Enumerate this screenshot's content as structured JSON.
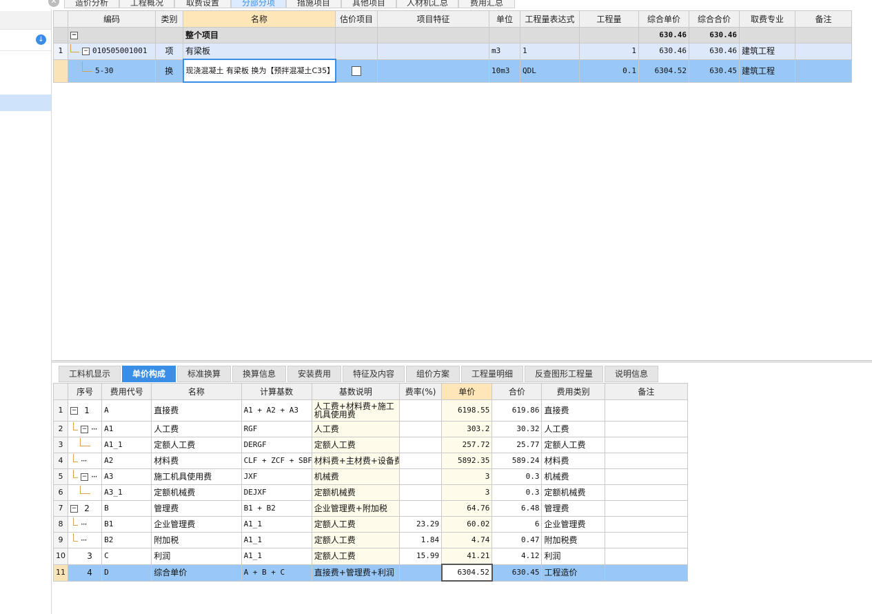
{
  "top_tabs": [
    "造价分析",
    "工程概况",
    "取费设置",
    "分部分项",
    "措施项目",
    "其他项目",
    "人材机汇总",
    "费用汇总"
  ],
  "top_tab_active": 3,
  "close_glyph": "✕",
  "sidebar": {
    "download_glyph": "↓"
  },
  "upper_table": {
    "headers": [
      "编码",
      "类别",
      "名称",
      "估价项目",
      "项目特征",
      "单位",
      "工程量表达式",
      "工程量",
      "综合单价",
      "综合合价",
      "取费专业",
      "备注"
    ],
    "total_row": {
      "name": "整个项目",
      "unit_price": "630.46",
      "total": "630.46"
    },
    "rows": [
      {
        "index": "1",
        "code": "010505001001",
        "category": "项",
        "name": "有梁板",
        "unit": "m3",
        "qty_expr": "1",
        "qty": "1",
        "unit_price": "630.46",
        "total": "630.46",
        "fee_type": "建筑工程",
        "remark": ""
      },
      {
        "index": "",
        "code": "5-30",
        "category": "换",
        "name": "现浇混凝土 有梁板   换为【预拌混凝土C35】",
        "unit": "10m3",
        "qty_expr": "QDL",
        "qty": "0.1",
        "unit_price": "6304.52",
        "total": "630.45",
        "fee_type": "建筑工程",
        "remark": ""
      }
    ]
  },
  "bottom_tabs": [
    "工料机显示",
    "单价构成",
    "标准换算",
    "换算信息",
    "安装费用",
    "特征及内容",
    "组价方案",
    "工程量明细",
    "反查图形工程量",
    "说明信息"
  ],
  "bottom_tab_active": 1,
  "lower_table": {
    "headers": [
      "序号",
      "费用代号",
      "名称",
      "计算基数",
      "基数说明",
      "费率(%)",
      "单价",
      "合价",
      "费用类别",
      "备注"
    ],
    "rows": [
      {
        "index": "1",
        "seq": "1",
        "code": "A",
        "name": "直接费",
        "base": "A1 + A2 + A3",
        "base_desc": "人工费+材料费+施工机具使用费",
        "rate": "",
        "unit_price": "6198.55",
        "total": "619.86",
        "fee_cat": "直接费",
        "remark": ""
      },
      {
        "index": "2",
        "seq": "",
        "code": "A1",
        "name": "人工费",
        "base": "RGF",
        "base_desc": "人工费",
        "rate": "",
        "unit_price": "303.2",
        "total": "30.32",
        "fee_cat": "人工费",
        "remark": ""
      },
      {
        "index": "3",
        "seq": "",
        "code": "A1_1",
        "name": "定额人工费",
        "base": "DERGF",
        "base_desc": "定额人工费",
        "rate": "",
        "unit_price": "257.72",
        "total": "25.77",
        "fee_cat": "定额人工费",
        "remark": ""
      },
      {
        "index": "4",
        "seq": "",
        "code": "A2",
        "name": "材料费",
        "base": "CLF + ZCF + SBF",
        "base_desc": "材料费+主材费+设备费",
        "rate": "",
        "unit_price": "5892.35",
        "total": "589.24",
        "fee_cat": "材料费",
        "remark": ""
      },
      {
        "index": "5",
        "seq": "",
        "code": "A3",
        "name": "施工机具使用费",
        "base": "JXF",
        "base_desc": "机械费",
        "rate": "",
        "unit_price": "3",
        "total": "0.3",
        "fee_cat": "机械费",
        "remark": ""
      },
      {
        "index": "6",
        "seq": "",
        "code": "A3_1",
        "name": "定额机械费",
        "base": "DEJXF",
        "base_desc": "定额机械费",
        "rate": "",
        "unit_price": "3",
        "total": "0.3",
        "fee_cat": "定额机械费",
        "remark": ""
      },
      {
        "index": "7",
        "seq": "2",
        "code": "B",
        "name": "管理费",
        "base": "B1 + B2",
        "base_desc": "企业管理费+附加税",
        "rate": "",
        "unit_price": "64.76",
        "total": "6.48",
        "fee_cat": "管理费",
        "remark": ""
      },
      {
        "index": "8",
        "seq": "",
        "code": "B1",
        "name": "企业管理费",
        "base": "A1_1",
        "base_desc": "定额人工费",
        "rate": "23.29",
        "unit_price": "60.02",
        "total": "6",
        "fee_cat": "企业管理费",
        "remark": ""
      },
      {
        "index": "9",
        "seq": "",
        "code": "B2",
        "name": "附加税",
        "base": "A1_1",
        "base_desc": "定额人工费",
        "rate": "1.84",
        "unit_price": "4.74",
        "total": "0.47",
        "fee_cat": "附加税费",
        "remark": ""
      },
      {
        "index": "10",
        "seq": "3",
        "code": "C",
        "name": "利润",
        "base": "A1_1",
        "base_desc": "定额人工费",
        "rate": "15.99",
        "unit_price": "41.21",
        "total": "4.12",
        "fee_cat": "利润",
        "remark": ""
      },
      {
        "index": "11",
        "seq": "4",
        "code": "D",
        "name": "综合单价",
        "base": "A + B + C",
        "base_desc": "直接费+管理费+利润",
        "rate": "",
        "unit_price": "6304.52",
        "total": "630.45",
        "fee_cat": "工程造价",
        "remark": ""
      }
    ]
  },
  "chart_data": {
    "type": "table",
    "tables": [
      {
        "name": "分部分项",
        "columns": [
          "编码",
          "类别",
          "名称",
          "单位",
          "工程量表达式",
          "工程量",
          "综合单价",
          "综合合价",
          "取费专业"
        ],
        "rows": [
          [
            "010505001001",
            "项",
            "有梁板",
            "m3",
            "1",
            "1",
            "630.46",
            "630.46",
            "建筑工程"
          ],
          [
            "5-30",
            "换",
            "现浇混凝土 有梁板   换为【预拌混凝土C35】",
            "10m3",
            "QDL",
            "0.1",
            "6304.52",
            "630.45",
            "建筑工程"
          ]
        ],
        "total": [
          "整个项目",
          "630.46",
          "630.46"
        ]
      },
      {
        "name": "单价构成",
        "columns": [
          "序号",
          "费用代号",
          "名称",
          "计算基数",
          "基数说明",
          "费率(%)",
          "单价",
          "合价",
          "费用类别"
        ],
        "rows": [
          [
            "1",
            "A",
            "直接费",
            "A1 + A2 + A3",
            "人工费+材料费+施工机具使用费",
            "",
            "6198.55",
            "619.86",
            "直接费"
          ],
          [
            "",
            "A1",
            "人工费",
            "RGF",
            "人工费",
            "",
            "303.2",
            "30.32",
            "人工费"
          ],
          [
            "",
            "A1_1",
            "定额人工费",
            "DERGF",
            "定额人工费",
            "",
            "257.72",
            "25.77",
            "定额人工费"
          ],
          [
            "",
            "A2",
            "材料费",
            "CLF + ZCF + SBF",
            "材料费+主材费+设备费",
            "",
            "5892.35",
            "589.24",
            "材料费"
          ],
          [
            "",
            "A3",
            "施工机具使用费",
            "JXF",
            "机械费",
            "",
            "3",
            "0.3",
            "机械费"
          ],
          [
            "",
            "A3_1",
            "定额机械费",
            "DEJXF",
            "定额机械费",
            "",
            "3",
            "0.3",
            "定额机械费"
          ],
          [
            "2",
            "B",
            "管理费",
            "B1 + B2",
            "企业管理费+附加税",
            "",
            "64.76",
            "6.48",
            "管理费"
          ],
          [
            "",
            "B1",
            "企业管理费",
            "A1_1",
            "定额人工费",
            "23.29",
            "60.02",
            "6",
            "企业管理费"
          ],
          [
            "",
            "B2",
            "附加税",
            "A1_1",
            "定额人工费",
            "1.84",
            "4.74",
            "0.47",
            "附加税费"
          ],
          [
            "3",
            "C",
            "利润",
            "A1_1",
            "定额人工费",
            "15.99",
            "41.21",
            "4.12",
            "利润"
          ],
          [
            "4",
            "D",
            "综合单价",
            "A + B + C",
            "直接费+管理费+利润",
            "",
            "6304.52",
            "630.45",
            "工程造价"
          ]
        ]
      }
    ]
  }
}
